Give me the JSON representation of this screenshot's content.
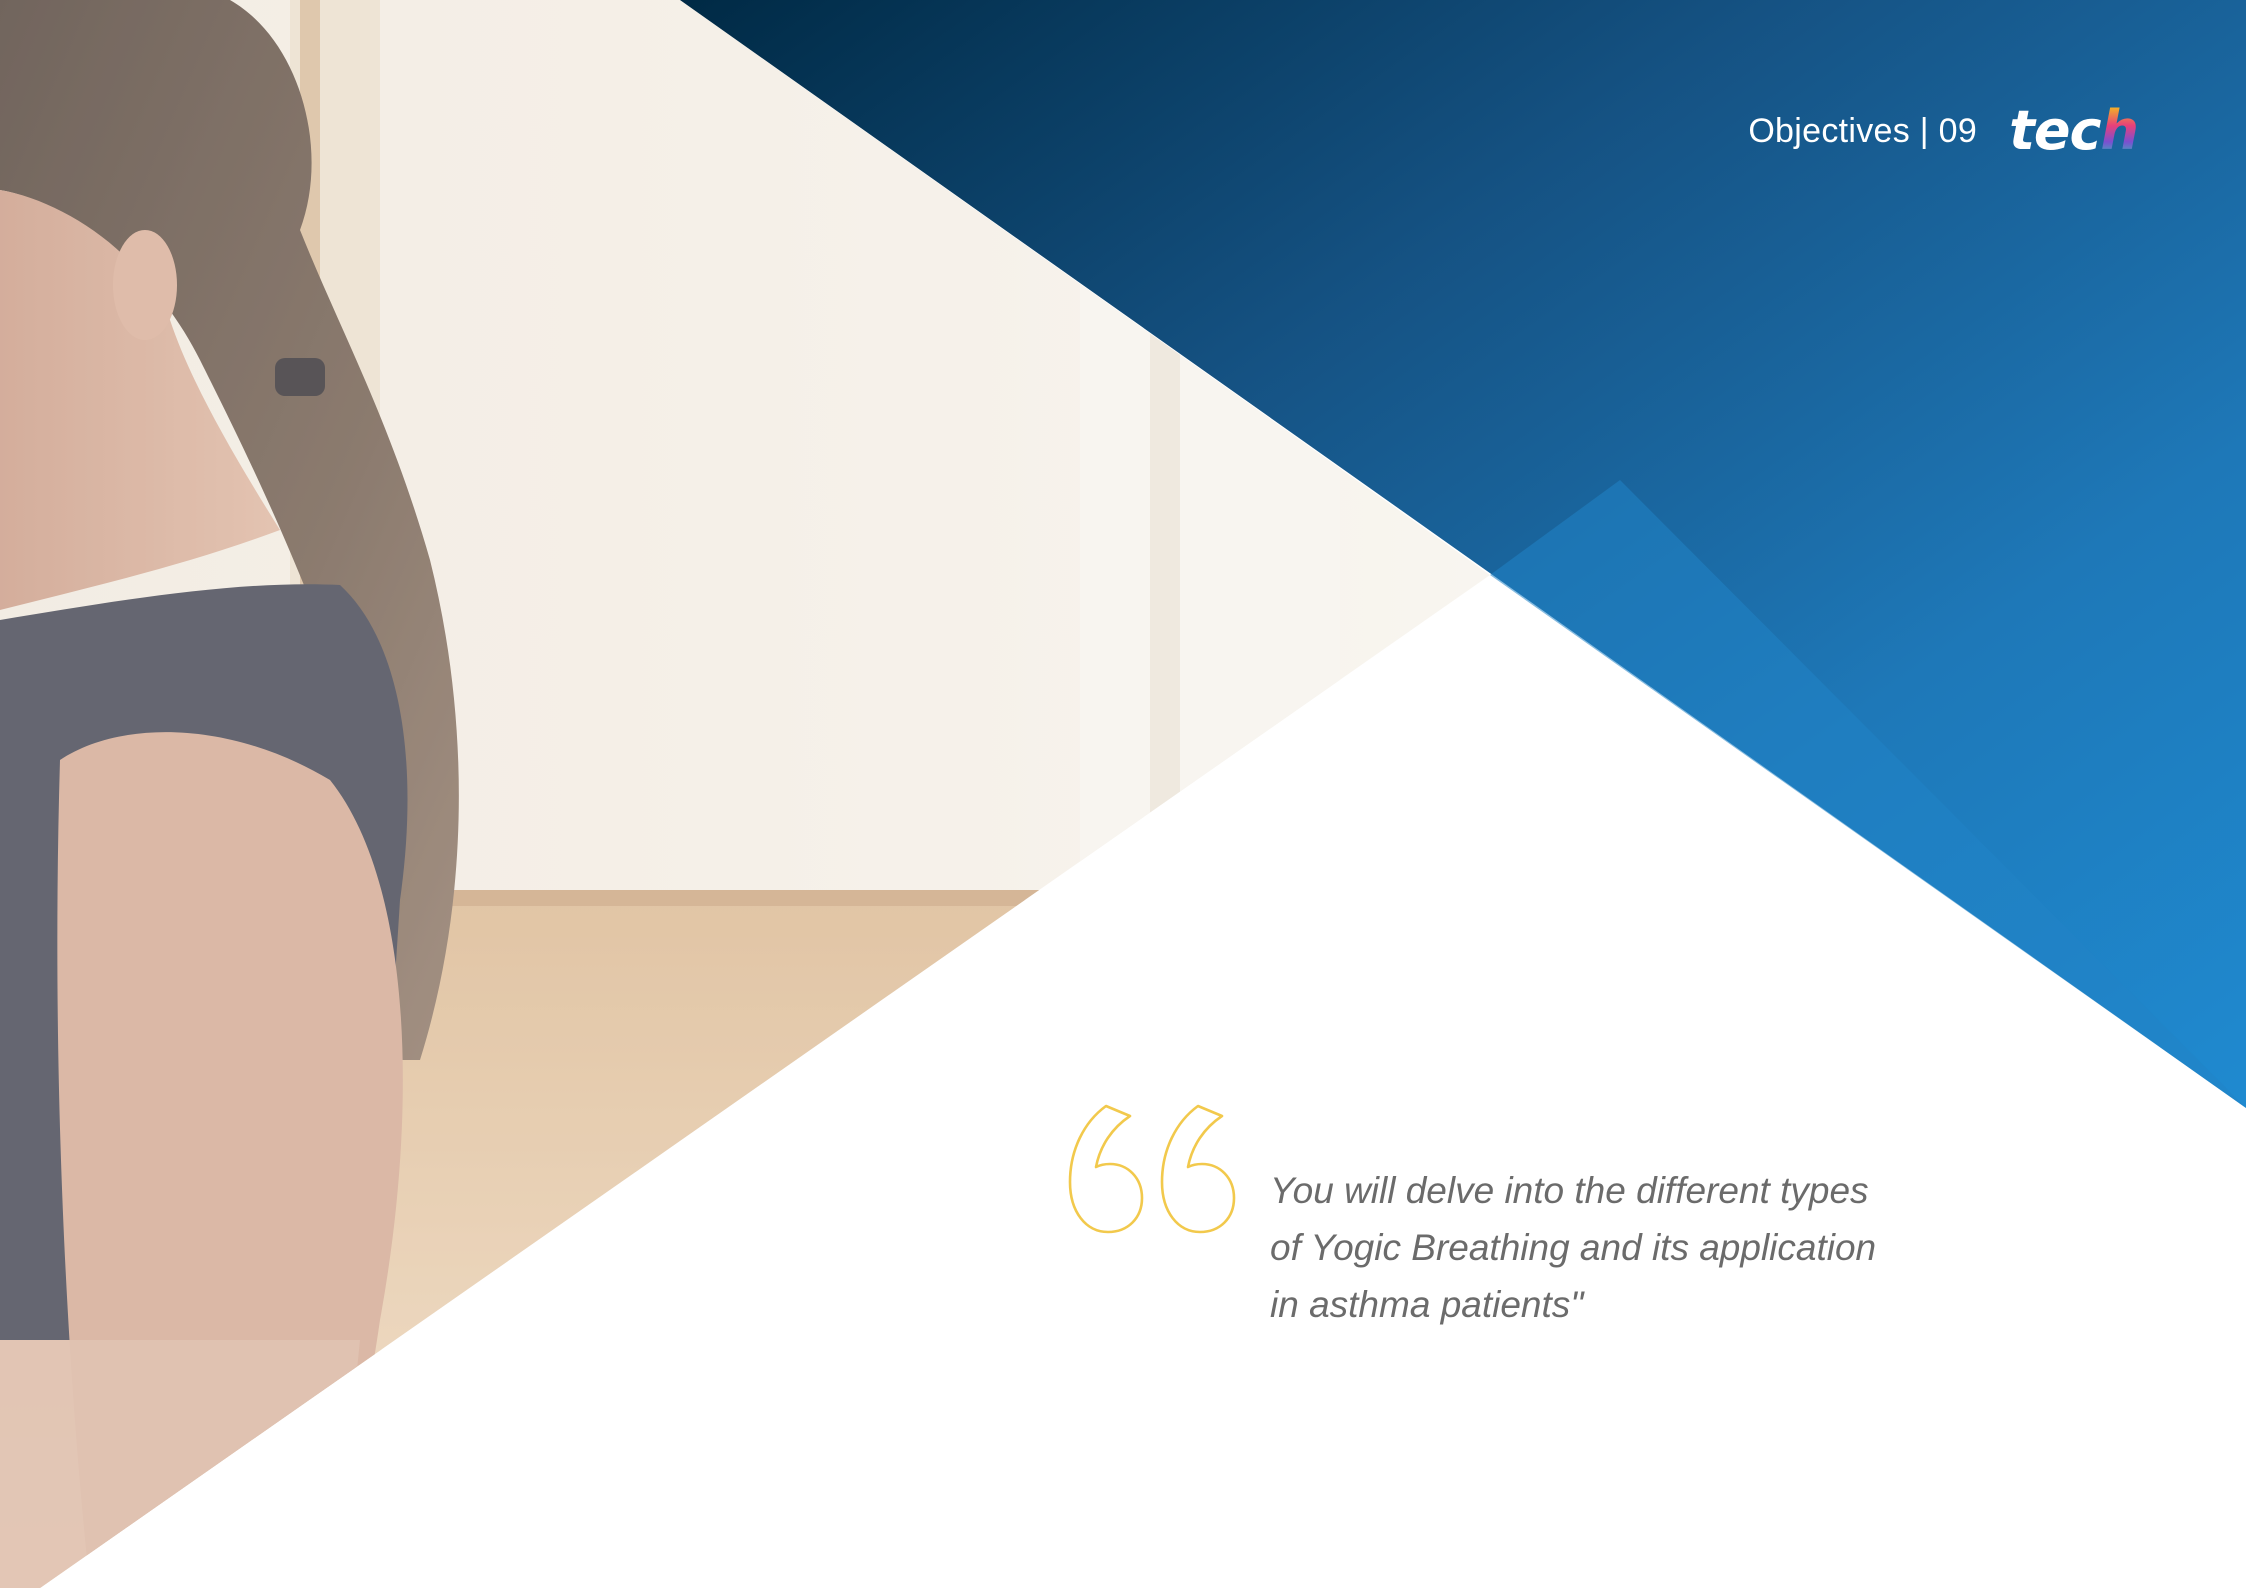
{
  "header": {
    "section_label": "Objectives | 09",
    "logo_text_main": "tec",
    "logo_text_accent": "h"
  },
  "quote": {
    "lines": [
      "You will delve into the different types",
      "of Yogic Breathing and its application",
      "in asthma patients\""
    ]
  },
  "colors": {
    "blue_dark": "#002a45",
    "blue_mid": "#1d5d8f",
    "blue_bright": "#1f88cc",
    "quote_mark_yellow": "#f2c94c",
    "quote_text": "#6b6b6b"
  },
  "icons": {
    "quote_mark": "open-quote-outline-icon"
  }
}
